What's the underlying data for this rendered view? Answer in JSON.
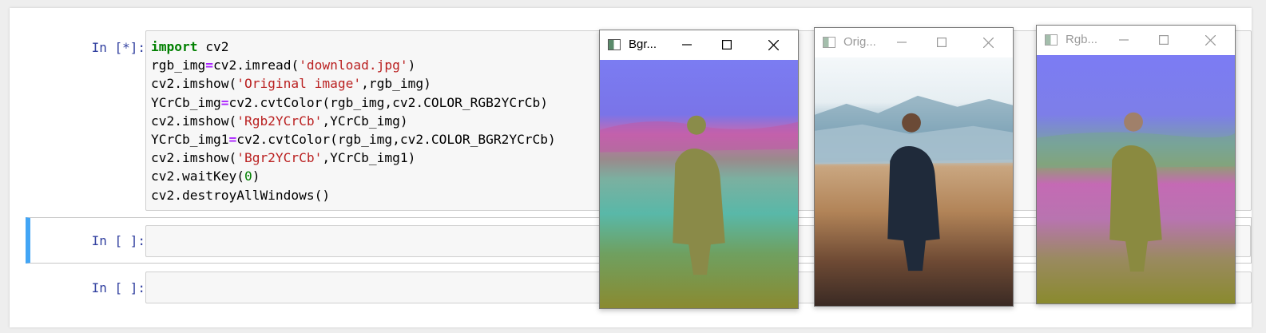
{
  "notebook": {
    "cells": [
      {
        "prompt": "In [*]:",
        "lines": [
          [
            {
              "t": "import",
              "c": "kw"
            },
            {
              "t": " cv2"
            }
          ],
          [
            {
              "t": "rgb_img"
            },
            {
              "t": "=",
              "c": "op"
            },
            {
              "t": "cv2.imread("
            },
            {
              "t": "'download.jpg'",
              "c": "str"
            },
            {
              "t": ")"
            }
          ],
          [
            {
              "t": "cv2.imshow("
            },
            {
              "t": "'Original image'",
              "c": "str"
            },
            {
              "t": ",rgb_img)"
            }
          ],
          [
            {
              "t": "YCrCb_img"
            },
            {
              "t": "=",
              "c": "op"
            },
            {
              "t": "cv2.cvtColor(rgb_img,cv2.COLOR_RGB2YCrCb)"
            }
          ],
          [
            {
              "t": "cv2.imshow("
            },
            {
              "t": "'Rgb2YCrCb'",
              "c": "str"
            },
            {
              "t": ",YCrCb_img)"
            }
          ],
          [
            {
              "t": "YCrCb_img1"
            },
            {
              "t": "=",
              "c": "op"
            },
            {
              "t": "cv2.cvtColor(rgb_img,cv2.COLOR_BGR2YCrCb)"
            }
          ],
          [
            {
              "t": "cv2.imshow("
            },
            {
              "t": "'Bgr2YCrCb'",
              "c": "str"
            },
            {
              "t": ",YCrCb_img1)"
            }
          ],
          [
            {
              "t": "cv2.waitKey("
            },
            {
              "t": "0",
              "c": "num"
            },
            {
              "t": ")"
            }
          ],
          [
            {
              "t": "cv2.destroyAllWindows()"
            }
          ]
        ]
      },
      {
        "prompt": "In [ ]:",
        "lines": []
      },
      {
        "prompt": "In [ ]:",
        "lines": []
      }
    ]
  },
  "windows": [
    {
      "id": "bgr",
      "title": "Bgr...",
      "active": true,
      "scene": "bgr2ycrcb"
    },
    {
      "id": "orig",
      "title": "Orig...",
      "active": false,
      "scene": "original"
    },
    {
      "id": "rgb",
      "title": "Rgb...",
      "active": false,
      "scene": "rgb2ycrcb"
    }
  ],
  "icons": {
    "minimize": "minimize-icon",
    "maximize": "maximize-icon",
    "close": "close-icon",
    "app": "opencv-window-icon"
  }
}
